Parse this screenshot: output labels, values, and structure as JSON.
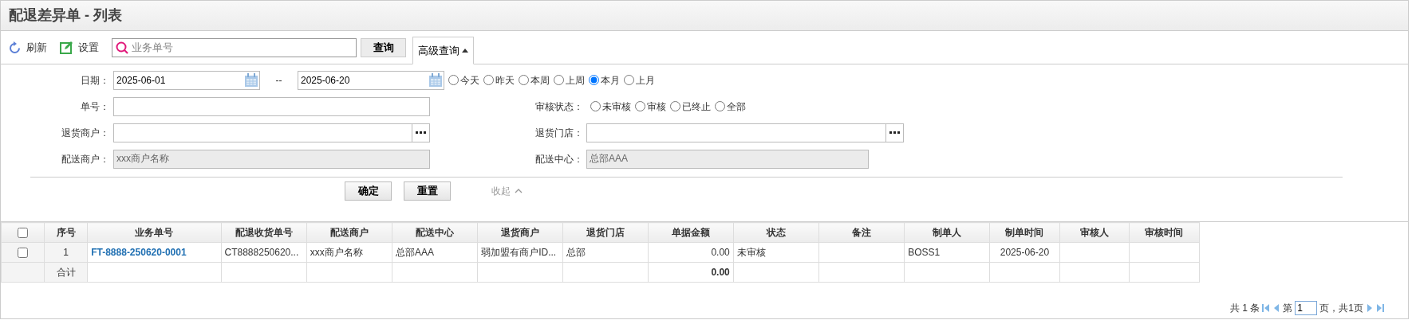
{
  "page": {
    "title": "配退差异单 - 列表"
  },
  "toolbar": {
    "buttons": [
      {
        "label": "刷新",
        "kind": "refresh"
      },
      {
        "label": "设置",
        "kind": "edit"
      }
    ],
    "search": {
      "placeholder": "业务单号"
    },
    "search_button": "查询",
    "advanced_tab": {
      "label": "高级查询",
      "expanded": true
    }
  },
  "filters": {
    "date": {
      "label": "日期：",
      "from": "2025-06-01",
      "separator": "--",
      "to": "2025-06-20",
      "presets": [
        {
          "label": "今天",
          "selected": false
        },
        {
          "label": "昨天",
          "selected": false
        },
        {
          "label": "本周",
          "selected": false
        },
        {
          "label": "上周",
          "selected": false
        },
        {
          "label": "本月",
          "selected": true
        },
        {
          "label": "上月",
          "selected": false
        }
      ]
    },
    "order_no": {
      "label": "单号："
    },
    "audit_status": {
      "label": "审核状态：",
      "options": [
        {
          "label": "未审核",
          "selected": false
        },
        {
          "label": "审核",
          "selected": false
        },
        {
          "label": "已终止",
          "selected": false
        },
        {
          "label": "全部",
          "selected": false
        }
      ]
    },
    "return_merchant": {
      "label": "退货商户："
    },
    "return_store": {
      "label": "退货门店："
    },
    "delivery_merchant": {
      "label": "配送商户：",
      "value": "xxx商户名称",
      "disabled": true
    },
    "delivery_center": {
      "label": "配送中心：",
      "value": "总部AAA",
      "disabled": true
    }
  },
  "actions": {
    "confirm": "确定",
    "reset": "重置",
    "collapse": "收起"
  },
  "table": {
    "columns": [
      {
        "kind": "check"
      },
      {
        "kind": "index",
        "label": "序号"
      },
      {
        "kind": "link",
        "label": "业务单号"
      },
      {
        "kind": "text",
        "label": "配退收货单号"
      },
      {
        "kind": "text",
        "label": "配送商户"
      },
      {
        "kind": "text",
        "label": "配送中心"
      },
      {
        "kind": "text",
        "label": "退货商户"
      },
      {
        "kind": "text",
        "label": "退货门店"
      },
      {
        "kind": "amount",
        "label": "单据金额"
      },
      {
        "kind": "text",
        "label": "状态"
      },
      {
        "kind": "text",
        "label": "备注"
      },
      {
        "kind": "text",
        "label": "制单人"
      },
      {
        "kind": "center",
        "label": "制单时间"
      },
      {
        "kind": "text",
        "label": "审核人"
      },
      {
        "kind": "text",
        "label": "审核时间"
      }
    ],
    "header_checked": false,
    "rows": [
      {
        "selected": false,
        "cells": [
          null,
          "1",
          "FT-8888-250620-0001",
          "CT8888250620...",
          "xxx商户名称",
          "总部AAA",
          "弱加盟有商户ID...",
          "总部",
          "0.00",
          "未审核",
          null,
          "BOSS1",
          "2025-06-20",
          null,
          null
        ]
      }
    ],
    "totals": {
      "label": "合计",
      "amount": "0.00"
    }
  },
  "pagination": {
    "total": "共 1 条",
    "page_prefix": "第",
    "page": "1",
    "page_suffix": "页，共1页"
  }
}
